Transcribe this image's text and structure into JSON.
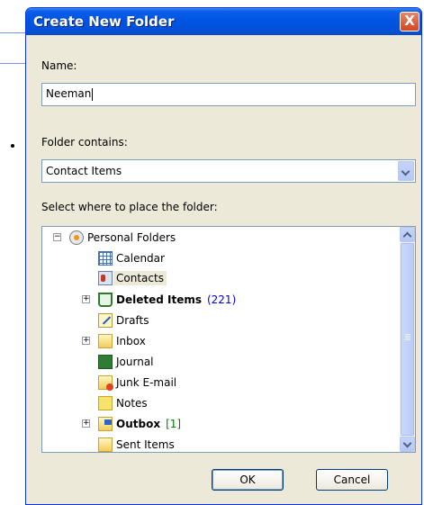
{
  "dialog": {
    "title": "Create New Folder",
    "close_label": "X",
    "name_label": "Name:",
    "name_value": "Neeman",
    "contains_label": "Folder contains:",
    "contains_value": "Contact Items",
    "place_label": "Select where to place the folder:",
    "ok_label": "OK",
    "cancel_label": "Cancel"
  },
  "tree": {
    "root": {
      "label": "Personal Folders",
      "expander": "−",
      "icon": "personal-folders-icon"
    },
    "items": [
      {
        "label": "Calendar",
        "icon": "calendar-icon"
      },
      {
        "label": "Contacts",
        "icon": "contacts-icon",
        "selected": true
      },
      {
        "label": "Deleted Items",
        "count": "(221)",
        "icon": "trash-icon",
        "bold": true,
        "expander": "+"
      },
      {
        "label": "Drafts",
        "icon": "drafts-icon"
      },
      {
        "label": "Inbox",
        "icon": "inbox-icon",
        "expander": "+"
      },
      {
        "label": "Journal",
        "icon": "journal-icon"
      },
      {
        "label": "Junk E-mail",
        "icon": "junk-email-icon"
      },
      {
        "label": "Notes",
        "icon": "notes-icon"
      },
      {
        "label": "Outbox",
        "count": "[1]",
        "icon": "outbox-icon",
        "bold": true,
        "expander": "+"
      },
      {
        "label": "Sent Items",
        "icon": "sent-items-icon"
      }
    ]
  },
  "colors": {
    "titlebar": "#0054e3",
    "dialog_bg": "#ece9d8",
    "count_blue": "#0000ee",
    "count_green": "#008000"
  }
}
